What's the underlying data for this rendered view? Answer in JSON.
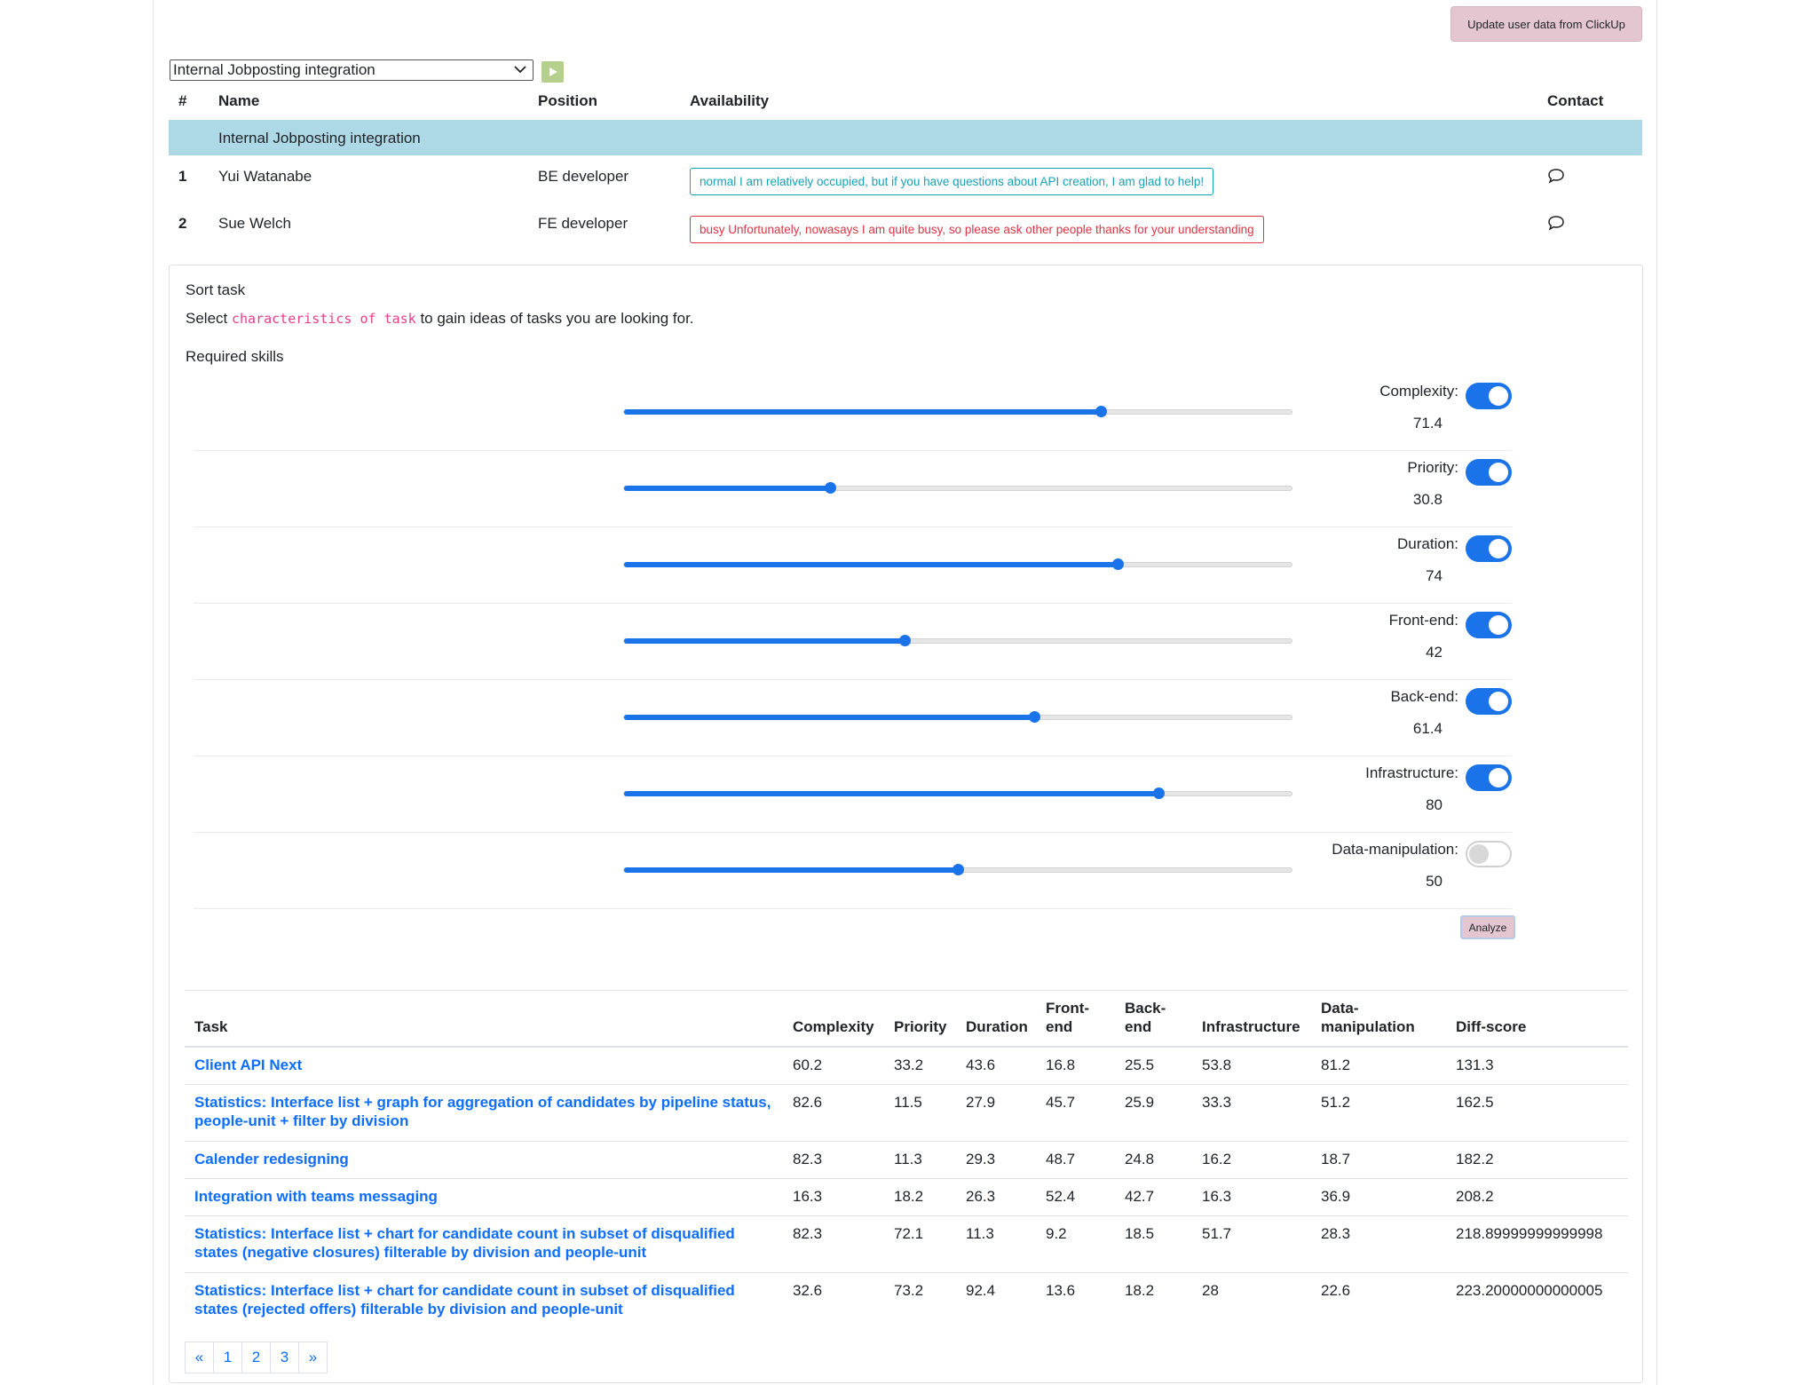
{
  "header": {
    "update_button": "Update user data from ClickUp"
  },
  "project_select": {
    "selected": "Internal Jobposting integration"
  },
  "team_table": {
    "columns": {
      "num": "#",
      "name": "Name",
      "position": "Position",
      "availability": "Availability",
      "contact": "Contact"
    },
    "group": "Internal Jobposting integration",
    "members": [
      {
        "num": "1",
        "name": "Yui Watanabe",
        "position": "BE developer",
        "availability": "normal I am relatively occupied, but if you have questions about API creation, I am glad to help!",
        "status": "normal"
      },
      {
        "num": "2",
        "name": "Sue Welch",
        "position": "FE developer",
        "availability": "busy Unfortunately, nowasays I am quite busy, so please ask other people thanks for your understanding",
        "status": "busy"
      }
    ]
  },
  "sort": {
    "title": "Sort task",
    "intro_prefix": "Select",
    "intro_code": "characteristics of task",
    "intro_suffix": "to gain ideas of tasks you are looking for.",
    "section_label": "Required skills"
  },
  "skills": [
    {
      "label": "Complexity:",
      "value": "71.4",
      "enabled": true
    },
    {
      "label": "Priority:",
      "value": "30.8",
      "enabled": true
    },
    {
      "label": "Duration:",
      "value": "74",
      "enabled": true
    },
    {
      "label": "Front-end:",
      "value": "42",
      "enabled": true
    },
    {
      "label": "Back-end:",
      "value": "61.4",
      "enabled": true
    },
    {
      "label": "Infrastructure:",
      "value": "80",
      "enabled": true
    },
    {
      "label": "Data-manipulation:",
      "value": "50",
      "enabled": false
    }
  ],
  "analyze_button": "Analyze",
  "results": {
    "headers": {
      "task": "Task",
      "complexity": "Complexity",
      "priority": "Priority",
      "duration": "Duration",
      "frontend": "Front-end",
      "backend": "Back-end",
      "infrastructure": "Infrastructure",
      "datamanipulation": "Data-manipulation",
      "diffscore": "Diff-score"
    },
    "rows": [
      {
        "task": "Client API Next",
        "complexity": "60.2",
        "priority": "33.2",
        "duration": "43.6",
        "frontend": "16.8",
        "backend": "25.5",
        "infrastructure": "53.8",
        "datamanipulation": "81.2",
        "diffscore": "131.3"
      },
      {
        "task": "Statistics: Interface list + graph for aggregation of candidates by pipeline status, people-unit + filter by division",
        "complexity": "82.6",
        "priority": "11.5",
        "duration": "27.9",
        "frontend": "45.7",
        "backend": "25.9",
        "infrastructure": "33.3",
        "datamanipulation": "51.2",
        "diffscore": "162.5"
      },
      {
        "task": "Calender redesigning",
        "complexity": "82.3",
        "priority": "11.3",
        "duration": "29.3",
        "frontend": "48.7",
        "backend": "24.8",
        "infrastructure": "16.2",
        "datamanipulation": "18.7",
        "diffscore": "182.2"
      },
      {
        "task": "Integration with teams messaging",
        "complexity": "16.3",
        "priority": "18.2",
        "duration": "26.3",
        "frontend": "52.4",
        "backend": "42.7",
        "infrastructure": "16.3",
        "datamanipulation": "36.9",
        "diffscore": "208.2"
      },
      {
        "task": "Statistics: Interface list + chart for candidate count in subset of disqualified states (negative closures) filterable by division and people-unit",
        "complexity": "82.3",
        "priority": "72.1",
        "duration": "11.3",
        "frontend": "9.2",
        "backend": "18.5",
        "infrastructure": "51.7",
        "datamanipulation": "28.3",
        "diffscore": "218.89999999999998"
      },
      {
        "task": "Statistics: Interface list + chart for candidate count in subset of disqualified states (rejected offers) filterable by division and people-unit",
        "complexity": "32.6",
        "priority": "73.2",
        "duration": "92.4",
        "frontend": "13.6",
        "backend": "18.2",
        "infrastructure": "28",
        "datamanipulation": "22.6",
        "diffscore": "223.20000000000005"
      }
    ]
  },
  "pagination": {
    "prev": "«",
    "pages": [
      "1",
      "2",
      "3"
    ],
    "next": "»"
  }
}
